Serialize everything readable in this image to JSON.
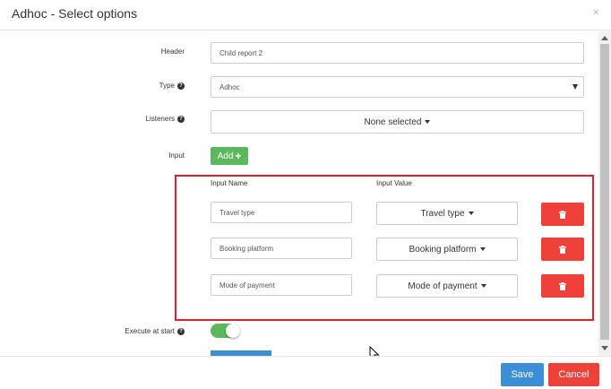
{
  "modal": {
    "title": "Adhoc - Select options",
    "close_symbol": "×"
  },
  "form": {
    "header_label": "Header",
    "header_value": "Child report 2",
    "type_label": "Type",
    "type_value": "Adhoc",
    "listeners_label": "Listeners",
    "listeners_value": "None selected",
    "input_label": "Input",
    "add_label": "Add",
    "add_symbol": "+",
    "execute_label": "Execute at start",
    "execute_enabled": true,
    "help_symbol": "?"
  },
  "inputs": {
    "name_header": "Input Name",
    "value_header": "Input Value",
    "rows": [
      {
        "name": "Travel type",
        "value": "Travel type"
      },
      {
        "name": "Booking platform",
        "value": "Booking platform"
      },
      {
        "name": "Mode of payment",
        "value": "Mode of payment"
      }
    ]
  },
  "footer": {
    "save_label": "Save",
    "cancel_label": "Cancel"
  },
  "colors": {
    "primary": "#3c8ed6",
    "danger": "#f0403a",
    "success": "#5cb85c",
    "highlight": "#e0202b"
  },
  "icons": {
    "delete": "trash-icon",
    "help": "question-circle-icon",
    "add": "plus-icon"
  }
}
